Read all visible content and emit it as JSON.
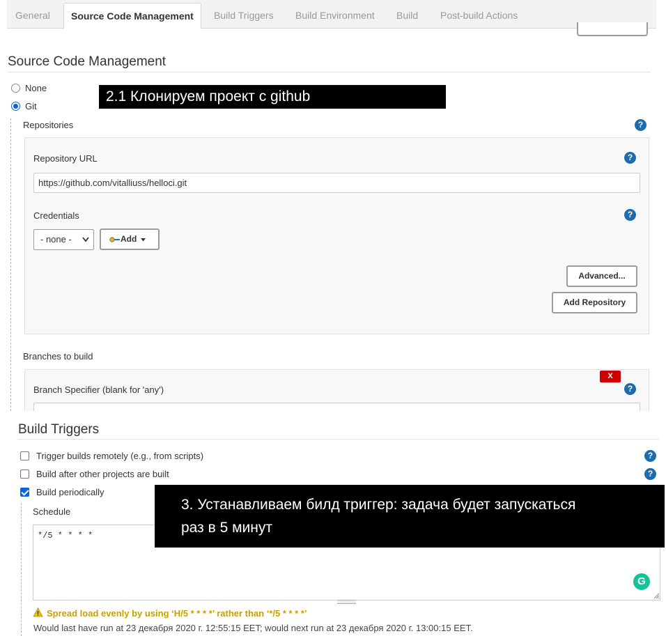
{
  "tabs": [
    {
      "label": "General",
      "active": false
    },
    {
      "label": "Source Code Management",
      "active": true
    },
    {
      "label": "Build Triggers",
      "active": false
    },
    {
      "label": "Build Environment",
      "active": false
    },
    {
      "label": "Build",
      "active": false
    },
    {
      "label": "Post-build Actions",
      "active": false
    }
  ],
  "scm": {
    "title": "Source Code Management",
    "options": [
      "None",
      "Git"
    ],
    "selected": "Git",
    "repositories_label": "Repositories",
    "repo_url_label": "Repository URL",
    "repo_url_value": "https://github.com/vitalliuss/helloci.git",
    "credentials_label": "Credentials",
    "credentials_selected": "- none -",
    "add_label": "Add",
    "advanced_label": "Advanced...",
    "add_repository_label": "Add Repository",
    "branches_label": "Branches to build",
    "branch_specifier_label": "Branch Specifier (blank for 'any')",
    "delete_label": "X"
  },
  "triggers": {
    "title": "Build Triggers",
    "items": [
      {
        "label": "Trigger builds remotely (e.g., from scripts)",
        "checked": false
      },
      {
        "label": "Build after other projects are built",
        "checked": false
      },
      {
        "label": "Build periodically",
        "checked": true
      }
    ],
    "schedule_label": "Schedule",
    "schedule_value": "*/5 * * * *",
    "warning": "Spread load evenly by using ‘H/5 * * * *’ rather than ‘*/5 * * * *’",
    "run_info": "Would last have run at 23 декабря 2020 г. 12:55:15 EET; would next run at 23 декабря 2020 г. 13:00:15 EET."
  },
  "annotations": {
    "note1": "2.1 Клонируем проект с github",
    "note2_line1": "3. Устанавливаем билд триггер: задача будет запускаться",
    "note2_line2": "раз в 5 минут"
  },
  "colors": {
    "help_blue": "#1d6cad",
    "check_blue": "#0b63d6",
    "delete_red": "#d10000",
    "warning_yellow": "#c8a100"
  },
  "icons": {
    "help": "question-circle-icon",
    "credentials_key": "key-icon",
    "dropdown": "caret-down-icon",
    "warning": "warning-triangle-icon",
    "grammarly": "grammarly-icon",
    "resize": "resize-handle-icon"
  }
}
